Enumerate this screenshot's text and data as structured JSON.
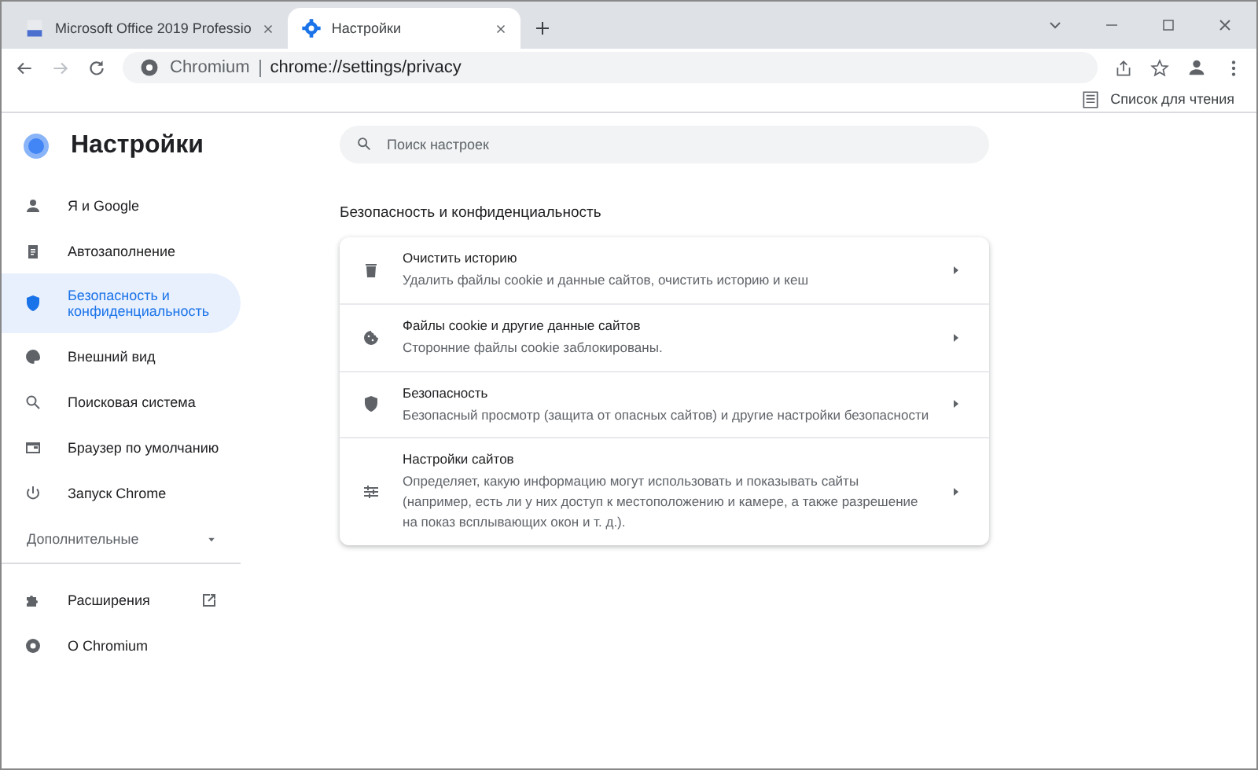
{
  "tabs": [
    {
      "title": "Microsoft Office 2019 Professio",
      "kind": "doc",
      "selected": false
    },
    {
      "title": "Настройки",
      "kind": "gear",
      "selected": true
    }
  ],
  "address": {
    "site": "Chromium",
    "url": "chrome://settings/privacy"
  },
  "reading_list": "Список для чтения",
  "app_title": "Настройки",
  "search": {
    "placeholder": "Поиск настроек"
  },
  "sidebar": [
    {
      "label": "Я и Google",
      "kind": "person",
      "selected": false
    },
    {
      "label": "Автозаполнение",
      "kind": "clipboard",
      "selected": false
    },
    {
      "label": "Безопасность и конфиденциальность",
      "kind": "shield",
      "selected": true
    },
    {
      "label": "Внешний вид",
      "kind": "palette",
      "selected": false
    },
    {
      "label": "Поисковая система",
      "kind": "search",
      "selected": false
    },
    {
      "label": "Браузер по умолчанию",
      "kind": "browser",
      "selected": false
    },
    {
      "label": "Запуск Chrome",
      "kind": "power",
      "selected": false
    }
  ],
  "advanced": {
    "label": "Дополнительные",
    "expanded": false
  },
  "sidebar_bottom": [
    {
      "label": "Расширения",
      "kind": "puzzle",
      "external": true
    },
    {
      "label": "О Chromium",
      "kind": "chromium",
      "external": false
    }
  ],
  "section_title": "Безопасность и конфиденциальность",
  "rows": [
    {
      "title": "Очистить историю",
      "subtitle": "Удалить файлы cookie и данные сайтов, очистить историю и кеш",
      "kind": "trash"
    },
    {
      "title": "Файлы cookie и другие данные сайтов",
      "subtitle": "Сторонние файлы cookie заблокированы.",
      "kind": "cookie"
    },
    {
      "title": "Безопасность",
      "subtitle": "Безопасный просмотр (защита от опасных сайтов) и другие настройки безопасности",
      "kind": "shield"
    },
    {
      "title": "Настройки сайтов",
      "subtitle": "Определяет, какую информацию могут использовать и показывать сайты (например, есть ли у них доступ к местоположению и камере, а также разрешение на показ всплывающих окон и т. д.).",
      "kind": "sliders"
    }
  ]
}
